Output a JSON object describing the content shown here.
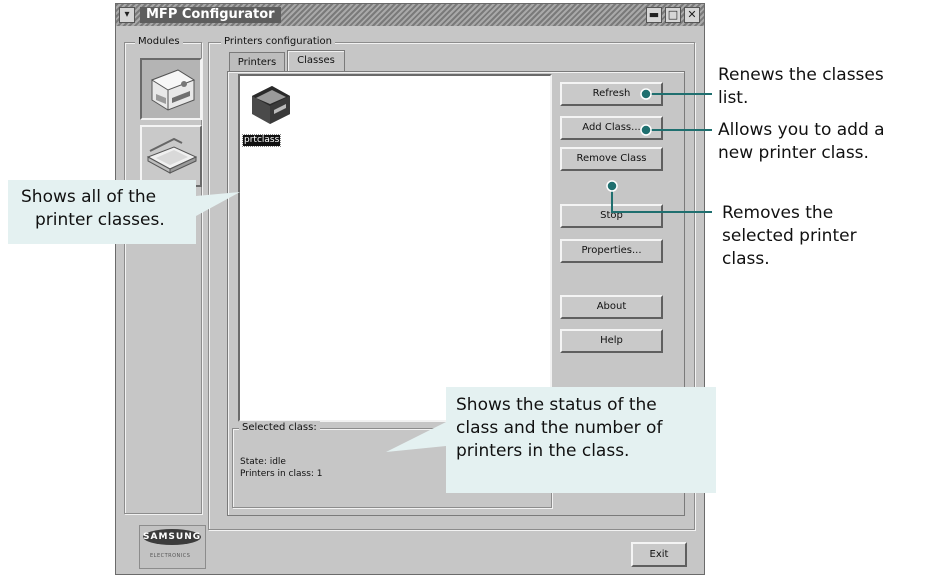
{
  "window": {
    "title": "MFP Configurator",
    "menu_glyph": "▾",
    "minimize_glyph": "▬",
    "maximize_glyph": "□",
    "close_glyph": "✕"
  },
  "modules": {
    "legend": "Modules",
    "items": [
      {
        "name": "Printers configuration",
        "icon": "printer-module-icon",
        "selected": true
      },
      {
        "name": "Scanners configuration",
        "icon": "scanner-module-icon",
        "selected": false
      }
    ],
    "brand": "SAMSUNG",
    "brand_sub": "ELECTRONICS"
  },
  "printers_config": {
    "legend": "Printers configuration",
    "tabs": [
      {
        "label": "Printers",
        "active": false
      },
      {
        "label": "Classes",
        "active": true
      }
    ],
    "classes": [
      {
        "name": "prtclass",
        "icon": "printer-class-icon",
        "selected": true
      }
    ],
    "buttons": {
      "refresh": "Refresh",
      "add_class": "Add Class...",
      "remove_class": "Remove Class",
      "stop": "Stop",
      "properties": "Properties...",
      "about": "About",
      "help": "Help"
    },
    "selected_class": {
      "legend": "Selected class:",
      "state": "State: idle",
      "printers_in_class": "Printers in class: 1"
    }
  },
  "exit_button": "Exit",
  "annotations": {
    "refresh": [
      "Renews the classes",
      "list."
    ],
    "add_class": [
      "Allows you to add a",
      "new printer class."
    ],
    "remove_class": [
      "Removes the",
      "selected printer",
      "class."
    ],
    "list": [
      "Shows all of the",
      "printer classes."
    ],
    "status": [
      "Shows the status of the",
      "class and the number of",
      "printers in the class."
    ]
  },
  "colors": {
    "callout_fill": "#e4f1f1",
    "pointer_teal": "#1f6f6f",
    "window_bg": "#c6c6c6"
  }
}
